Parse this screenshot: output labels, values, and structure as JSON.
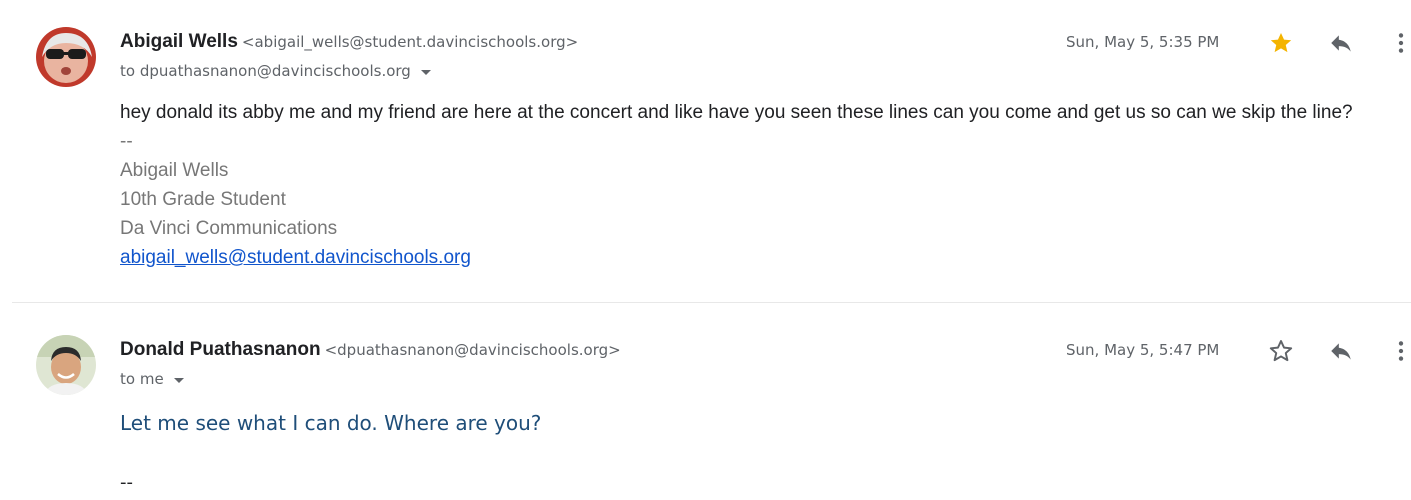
{
  "messages": [
    {
      "sender_name": "Abigail Wells",
      "sender_email": "<abigail_wells@student.davincischools.org>",
      "to": "to dpuathasnanon@davincischools.org",
      "timestamp": "Sun, May 5, 5:35 PM",
      "starred": true,
      "body": "hey donald its abby me and my friend are here at the concert and like have you seen these lines can you come and get us so can we skip the line?",
      "signature": {
        "separator": "--",
        "name": "Abigail Wells",
        "title": "10th Grade Student",
        "org": "Da Vinci Communications",
        "email_link": "abigail_wells@student.davincischools.org"
      }
    },
    {
      "sender_name": "Donald Puathasnanon",
      "sender_email": "<dpuathasnanon@davincischools.org>",
      "to": "to me",
      "timestamp": "Sun, May 5, 5:47 PM",
      "starred": false,
      "body": "Let me see what I can do. Where are you?",
      "signature_separator": "--"
    }
  ],
  "icons": {
    "star_filled": "star-filled-icon",
    "star_outline": "star-outline-icon",
    "reply": "reply-icon",
    "more": "more-vert-icon"
  },
  "colors": {
    "star_gold": "#f4b400",
    "link": "#1155cc",
    "reply_text": "#1f4e79"
  }
}
